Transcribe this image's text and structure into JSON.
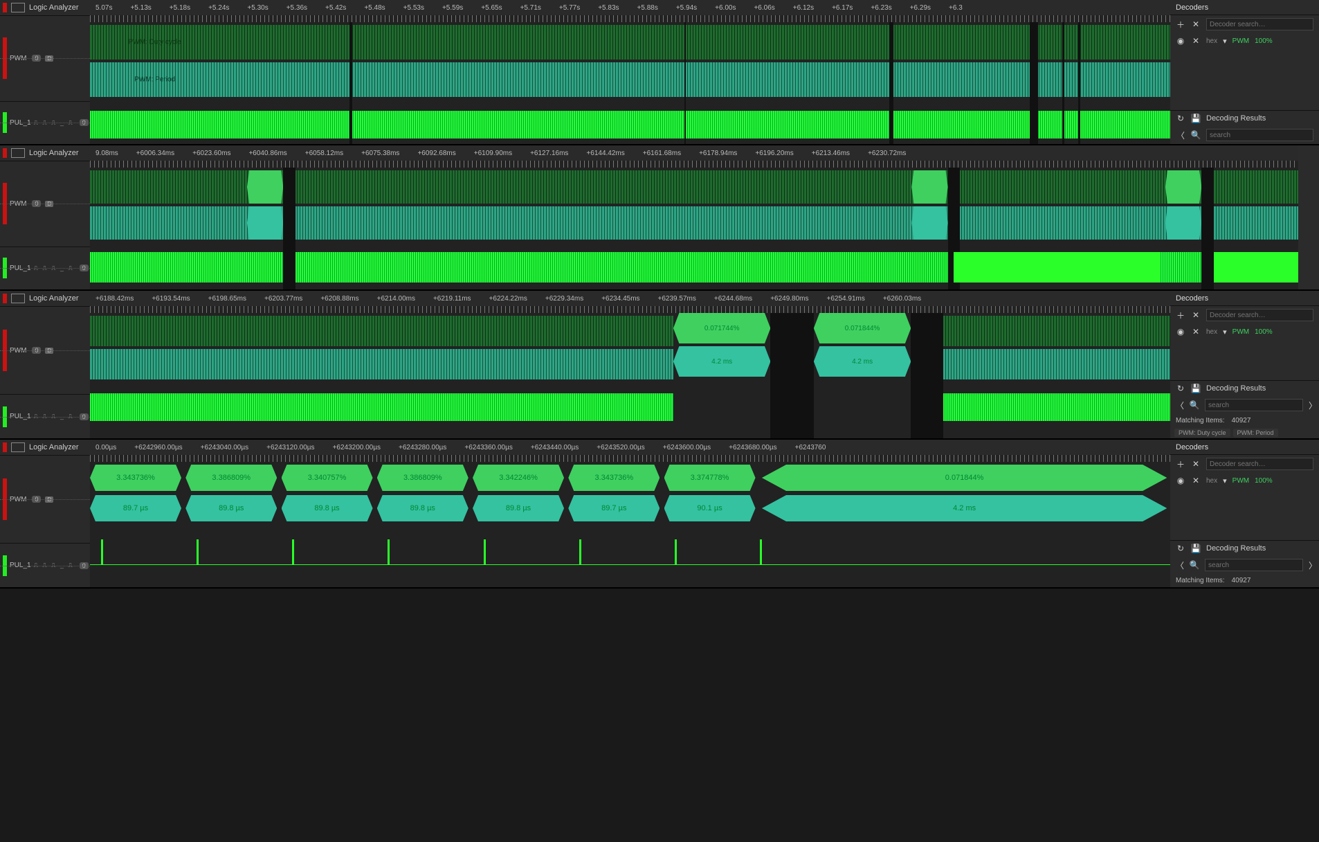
{
  "app_title": "Logic Analyzer",
  "channels": {
    "pwm": "PWM",
    "pul": "PUL_1"
  },
  "badges": {
    "zero": "0",
    "d": "D"
  },
  "edge_icons": "⎍ ⎍ ⎍ _ ⎍",
  "decoder_sidebar": {
    "title": "Decoders",
    "search_placeholder": "Decoder search…",
    "pwm_label": "PWM",
    "pwm_percent": "100%",
    "hex_label": "hex",
    "results_title": "Decoding Results",
    "results_search_placeholder": "search",
    "matching_label": "Matching Items:",
    "matching_count": "40927",
    "tab_duty": "PWM: Duty cycle",
    "tab_period": "PWM: Period"
  },
  "panels": [
    {
      "id": "p1",
      "time_ticks": [
        "5.07s",
        "+5.13s",
        "+5.18s",
        "+5.24s",
        "+5.30s",
        "+5.36s",
        "+5.42s",
        "+5.48s",
        "+5.53s",
        "+5.59s",
        "+5.65s",
        "+5.71s",
        "+5.77s",
        "+5.83s",
        "+5.88s",
        "+5.94s",
        "+6.00s",
        "+6.06s",
        "+6.12s",
        "+6.17s",
        "+6.23s",
        "+6.29s",
        "+6.3"
      ],
      "duty_label": "PWM: Duty cycle",
      "period_label": "PWM: Period"
    },
    {
      "id": "p2",
      "time_ticks": [
        "9.08ms",
        "+6006.34ms",
        "+6023.60ms",
        "+6040.86ms",
        "+6058.12ms",
        "+6075.38ms",
        "+6092.68ms",
        "+6109.90ms",
        "+6127.16ms",
        "+6144.42ms",
        "+6161.68ms",
        "+6178.94ms",
        "+6196.20ms",
        "+6213.46ms",
        "+6230.72ms"
      ]
    },
    {
      "id": "p3",
      "time_ticks": [
        "+6188.42ms",
        "+6193.54ms",
        "+6198.65ms",
        "+6203.77ms",
        "+6208.88ms",
        "+6214.00ms",
        "+6219.11ms",
        "+6224.22ms",
        "+6229.34ms",
        "+6234.45ms",
        "+6239.57ms",
        "+6244.68ms",
        "+6249.80ms",
        "+6254.91ms",
        "+6260.03ms"
      ],
      "flags": [
        {
          "duty": "0.071744%",
          "period": "4.2 ms",
          "left_pct": 54
        },
        {
          "duty": "0.071844%",
          "period": "4.2 ms",
          "left_pct": 67
        }
      ]
    },
    {
      "id": "p4",
      "time_ticks": [
        "0.00µs",
        "+6242960.00µs",
        "+6243040.00µs",
        "+6243120.00µs",
        "+6243200.00µs",
        "+6243280.00µs",
        "+6243360.00µs",
        "+6243440.00µs",
        "+6243520.00µs",
        "+6243600.00µs",
        "+6243680.00µs",
        "+6243760"
      ],
      "cells": [
        {
          "duty": "3.343736%",
          "period": "89.7 µs"
        },
        {
          "duty": "3.386809%",
          "period": "89.8 µs"
        },
        {
          "duty": "3.340757%",
          "period": "89.8 µs"
        },
        {
          "duty": "3.386809%",
          "period": "89.8 µs"
        },
        {
          "duty": "3.342246%",
          "period": "89.8 µs"
        },
        {
          "duty": "3.343736%",
          "period": "89.7 µs"
        },
        {
          "duty": "3.374778%",
          "period": "90.1 µs"
        }
      ],
      "tail": {
        "duty": "0.071844%",
        "period": "4.2 ms"
      }
    }
  ]
}
